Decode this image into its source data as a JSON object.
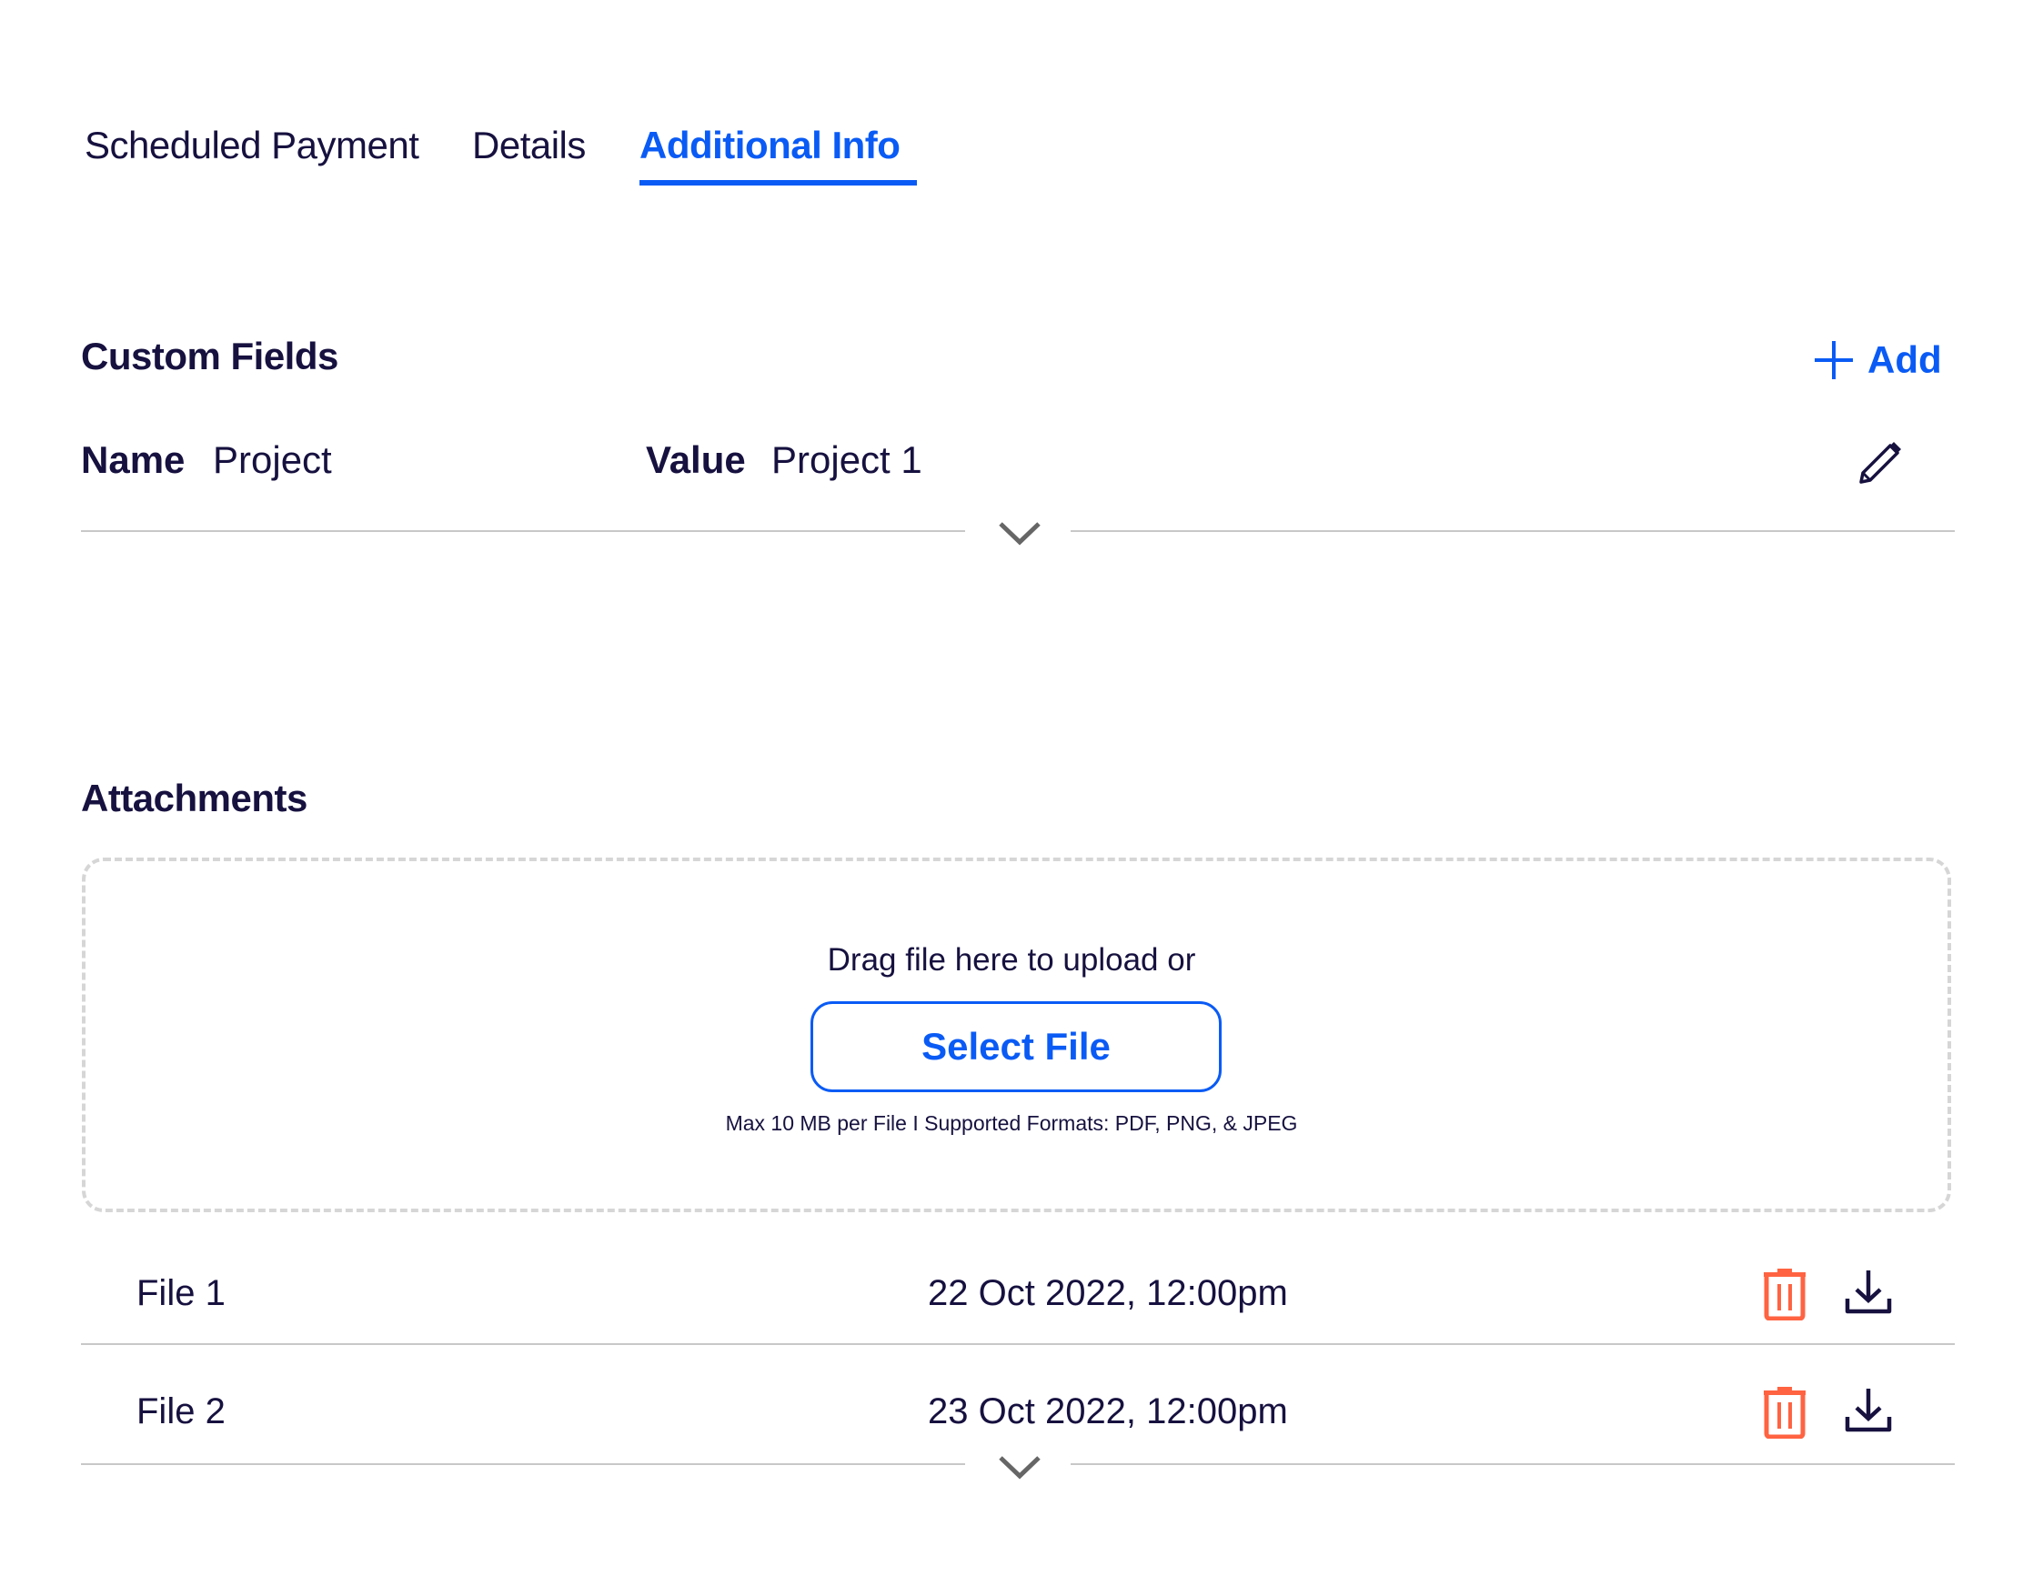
{
  "tabs": [
    {
      "label": "Scheduled Payment",
      "active": false
    },
    {
      "label": "Details",
      "active": false
    },
    {
      "label": "Additional Info",
      "active": true
    }
  ],
  "custom_fields": {
    "title": "Custom Fields",
    "add_label": "Add",
    "rows": [
      {
        "name_label": "Name",
        "name_value": "Project",
        "value_label": "Value",
        "value_value": "Project 1"
      }
    ]
  },
  "attachments": {
    "title": "Attachments",
    "drag_text": "Drag file here to upload or",
    "select_button": "Select File",
    "hint": "Max 10 MB per File  I  Supported Formats: PDF, PNG, & JPEG",
    "files": [
      {
        "name": "File 1",
        "date": "22 Oct 2022, 12:00pm"
      },
      {
        "name": "File 2",
        "date": "23 Oct 2022, 12:00pm"
      }
    ]
  },
  "colors": {
    "accent": "#0a5bf5",
    "text": "#16113f",
    "delete": "#ff6341",
    "divider": "#c8c8c8"
  },
  "icons": {
    "add": "plus-icon",
    "edit": "pencil-icon",
    "expand": "chevron-down-icon",
    "delete": "trash-icon",
    "download": "download-icon"
  }
}
